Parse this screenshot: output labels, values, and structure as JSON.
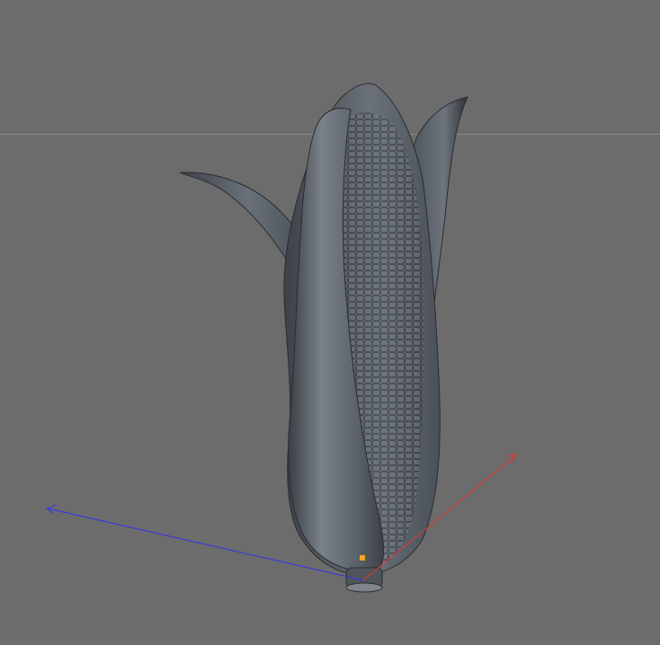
{
  "viewport": {
    "type": "3d-viewport",
    "object_name": "corn",
    "background_color": "#6c6c6c",
    "horizon_color": "#8a8a8a",
    "object_color": "#596068",
    "axes": {
      "x_color": "#d23a3a",
      "z_color": "#3a3ad8"
    },
    "pivot_handle_color": "#f5a623"
  }
}
